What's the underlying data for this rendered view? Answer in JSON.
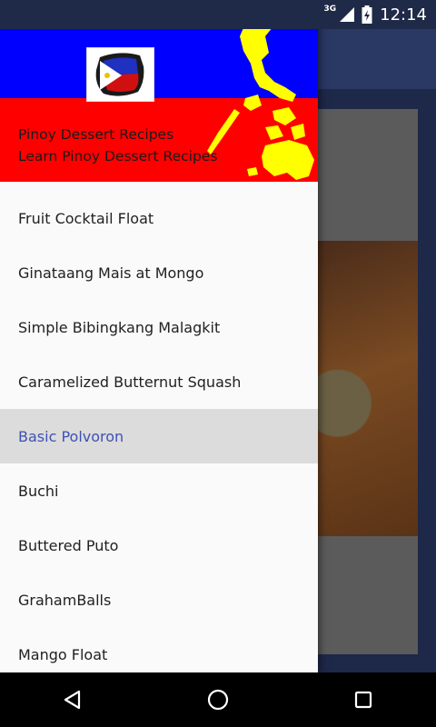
{
  "status_bar": {
    "network": "3G",
    "time": "12:14"
  },
  "drawer": {
    "header": {
      "title": "Pinoy Dessert Recipes",
      "subtitle": "Learn Pinoy Dessert Recipes"
    },
    "items": [
      {
        "label": "Fruit Cocktail Float"
      },
      {
        "label": "Ginataang Mais at Mongo"
      },
      {
        "label": "Simple Bibingkang Malagkit"
      },
      {
        "label": "Caramelized Butternut Squash"
      },
      {
        "label": "Basic Polvoron"
      },
      {
        "label": "Buchi"
      },
      {
        "label": "Buttered Puto"
      },
      {
        "label": "GrahamBalls"
      },
      {
        "label": "Mango Float"
      }
    ],
    "selected_index": 4
  },
  "colors": {
    "flag_blue": "#0000ff",
    "flag_red": "#ff0000",
    "map_yellow": "#ffff00",
    "selected_text": "#3f51b5"
  },
  "icons": {
    "back": "back-triangle-icon",
    "home": "home-circle-icon",
    "recents": "recents-square-icon"
  }
}
